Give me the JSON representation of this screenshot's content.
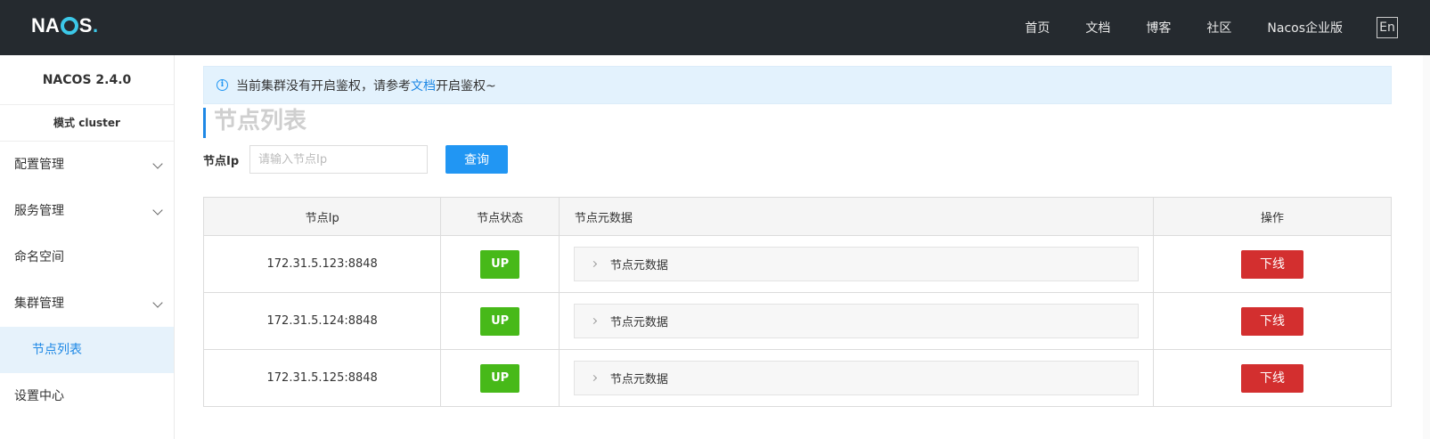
{
  "header": {
    "logo": "NACOS.",
    "nav": [
      "首页",
      "文档",
      "博客",
      "社区",
      "Nacos企业版"
    ],
    "lang": "En"
  },
  "sidebar": {
    "version": "NACOS 2.4.0",
    "mode": "模式 cluster",
    "items": [
      {
        "label": "配置管理"
      },
      {
        "label": "服务管理"
      },
      {
        "label": "命名空间"
      },
      {
        "label": "集群管理"
      },
      {
        "label": "节点列表"
      },
      {
        "label": "设置中心"
      }
    ]
  },
  "notice": {
    "text_before": "当前集群没有开启鉴权，请参考",
    "link": "文档",
    "text_after": "开启鉴权~"
  },
  "page_title": "节点列表",
  "search": {
    "label": "节点Ip",
    "placeholder": "请输入节点Ip",
    "button": "查询"
  },
  "table": {
    "headers": [
      "节点Ip",
      "节点状态",
      "节点元数据",
      "操作"
    ],
    "rows": [
      {
        "ip": "172.31.5.123:8848",
        "status": "UP",
        "meta": "节点元数据",
        "action": "下线"
      },
      {
        "ip": "172.31.5.124:8848",
        "status": "UP",
        "meta": "节点元数据",
        "action": "下线"
      },
      {
        "ip": "172.31.5.125:8848",
        "status": "UP",
        "meta": "节点元数据",
        "action": "下线"
      }
    ]
  },
  "colors": {
    "topbar": "#252a2f",
    "primary": "#2196f3",
    "up": "#47b919",
    "danger": "#d32f2f"
  }
}
